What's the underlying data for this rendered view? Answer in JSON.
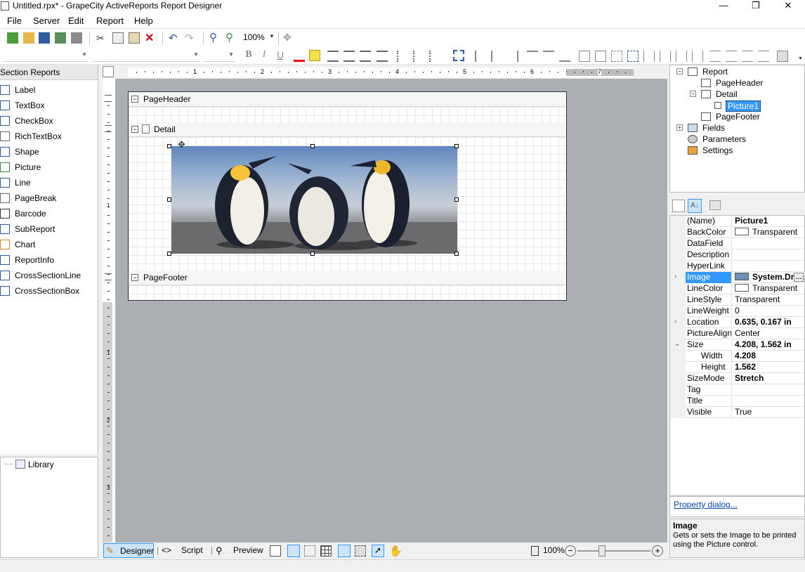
{
  "window": {
    "title": "Untitled.rpx* - GrapeCity ActiveReports Report Designer",
    "controls": [
      "—",
      "❐",
      "✕"
    ]
  },
  "menu": [
    "File",
    "Server",
    "Edit",
    "Report",
    "Help"
  ],
  "toolbar": {
    "zoom": "100%"
  },
  "format_toolbar": {
    "bold": "B",
    "italic": "I",
    "underline": "U"
  },
  "toolbox": {
    "header": "Section Reports",
    "items": [
      {
        "label": "Label",
        "icon": "label-icon"
      },
      {
        "label": "TextBox",
        "icon": "textbox-icon"
      },
      {
        "label": "CheckBox",
        "icon": "checkbox-icon"
      },
      {
        "label": "RichTextBox",
        "icon": "richtextbox-icon"
      },
      {
        "label": "Shape",
        "icon": "shape-icon"
      },
      {
        "label": "Picture",
        "icon": "picture-icon"
      },
      {
        "label": "Line",
        "icon": "line-icon"
      },
      {
        "label": "PageBreak",
        "icon": "pagebreak-icon"
      },
      {
        "label": "Barcode",
        "icon": "barcode-icon"
      },
      {
        "label": "SubReport",
        "icon": "subreport-icon"
      },
      {
        "label": "Chart",
        "icon": "chart-icon"
      },
      {
        "label": "ReportInfo",
        "icon": "reportinfo-icon"
      },
      {
        "label": "CrossSectionLine",
        "icon": "crosssectionline-icon"
      },
      {
        "label": "CrossSectionBox",
        "icon": "crosssectionbox-icon"
      }
    ]
  },
  "library": {
    "label": "Library"
  },
  "ruler": {
    "h_labels": [
      "1",
      "2",
      "3",
      "4",
      "5",
      "6",
      "7"
    ],
    "v_labels": [
      "1",
      "1",
      "2",
      "3"
    ]
  },
  "report": {
    "sections": {
      "page_header": "PageHeader",
      "detail": "Detail",
      "page_footer": "PageFooter"
    },
    "picture": {
      "name": "Picture1",
      "description": "Photograph of three penguins on a beach"
    }
  },
  "bottom": {
    "designer": "Designer",
    "script": "Script",
    "preview": "Preview",
    "zoom": "100%"
  },
  "tree": {
    "report": "Report",
    "page_header": "PageHeader",
    "detail": "Detail",
    "picture": "Picture1",
    "page_footer": "PageFooter",
    "fields": "Fields",
    "parameters": "Parameters",
    "settings": "Settings"
  },
  "properties": [
    {
      "name": "(Name)",
      "value": "Picture1",
      "bold": true
    },
    {
      "name": "BackColor",
      "value": "Transparent",
      "swatch": true
    },
    {
      "name": "DataField",
      "value": ""
    },
    {
      "name": "Description",
      "value": ""
    },
    {
      "name": "HyperLink",
      "value": ""
    },
    {
      "name": "Image",
      "value": "System.Dra...",
      "bold": true,
      "selected": true,
      "expand": "›"
    },
    {
      "name": "LineColor",
      "value": "Transparent",
      "swatch": true
    },
    {
      "name": "LineStyle",
      "value": "Transparent"
    },
    {
      "name": "LineWeight",
      "value": "0"
    },
    {
      "name": "Location",
      "value": "0.635, 0.167 in",
      "bold": true,
      "expand": "›"
    },
    {
      "name": "PictureAlignment",
      "value": "Center"
    },
    {
      "name": "Size",
      "value": "4.208, 1.562 in",
      "bold": true,
      "expand": "⌄"
    },
    {
      "name": "Width",
      "value": "4.208",
      "bold": true,
      "indent": true
    },
    {
      "name": "Height",
      "value": "1.562",
      "bold": true,
      "indent": true
    },
    {
      "name": "SizeMode",
      "value": "Stretch",
      "bold": true
    },
    {
      "name": "Tag",
      "value": ""
    },
    {
      "name": "Title",
      "value": ""
    },
    {
      "name": "Visible",
      "value": "True"
    }
  ],
  "property_link": "Property dialog...",
  "description": {
    "title": "Image",
    "text": "Gets or sets the Image to be printed using the Picture control."
  }
}
